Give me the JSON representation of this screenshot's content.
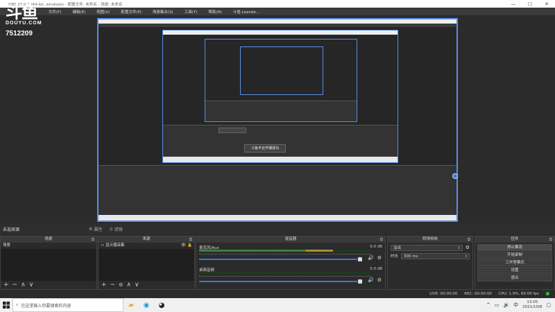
{
  "window": {
    "title": "OBS 27.0.1 (64-bit, windows) - 配置文件: 未命名 - 场景: 未命名",
    "controls": [
      "—",
      "☐",
      "✕"
    ]
  },
  "menu": [
    {
      "label": "文件(F)"
    },
    {
      "label": "编辑(E)"
    },
    {
      "label": "视图(V)"
    },
    {
      "label": "配置文件(P)"
    },
    {
      "label": "场景集合(S)"
    },
    {
      "label": "工具(T)"
    },
    {
      "label": "帮助(H)"
    },
    {
      "label": "斗鱼-Leande..."
    }
  ],
  "overlay": {
    "logo_text": "斗鱼",
    "logo_sub": "DOUYU.COM",
    "room_id": "7512209"
  },
  "preview": {
    "toast": "斗鱼平台开播成功"
  },
  "source_bar": {
    "label": "未选择源",
    "properties": "属性",
    "filters": "滤镜"
  },
  "scenes": {
    "title": "场景",
    "items": [
      "场景"
    ]
  },
  "sources": {
    "title": "来源",
    "items": [
      "显示器采集"
    ]
  },
  "mixer": {
    "title": "混音器",
    "channels": [
      {
        "name": "麦克风/Aux",
        "db": "0.0 dB",
        "level": 0.78
      },
      {
        "name": "桌面音频",
        "db": "0.0 dB",
        "level": 0.0
      }
    ]
  },
  "transitions": {
    "title": "转场特效",
    "type": "淡出",
    "duration_label": "时长",
    "duration": "300 ms"
  },
  "controls": {
    "title": "控件",
    "buttons": [
      "停止推流",
      "开始录制",
      "工作室模式",
      "设置",
      "退出"
    ]
  },
  "status": {
    "live": "LIVE: 00:00:00",
    "rec": "REC: 00:00:00",
    "cpu": "CPU: 1.9%, 60.00 fps"
  },
  "taskbar": {
    "search_placeholder": "在这里输入你要搜索的内容",
    "time": "13:05",
    "date": "2021/10/8"
  }
}
